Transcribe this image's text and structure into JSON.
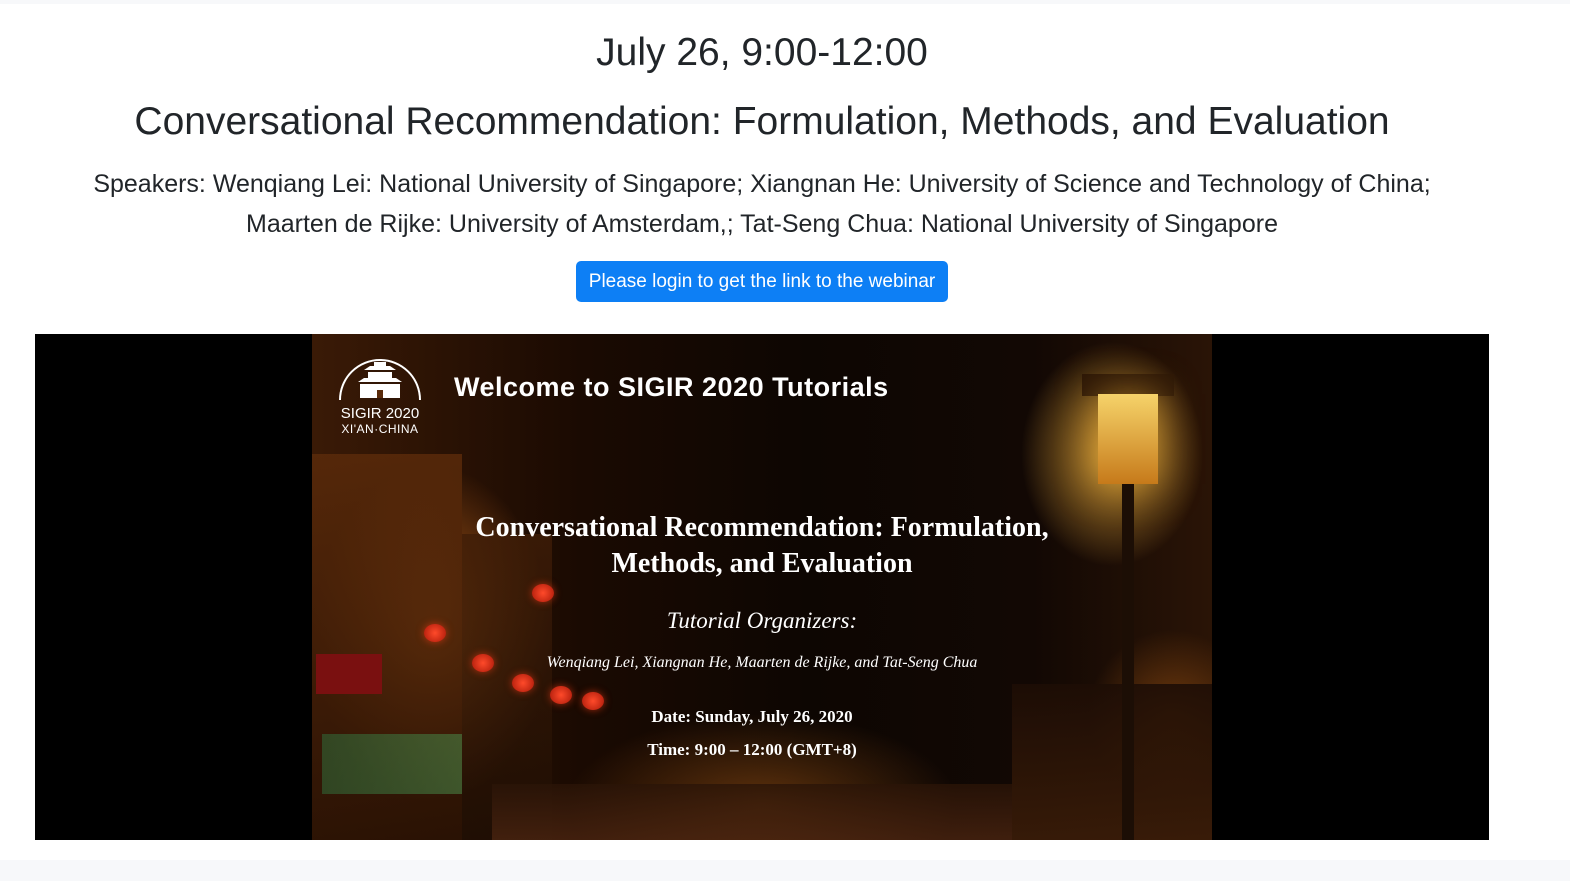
{
  "session": {
    "date_time": "July 26, 9:00-12:00",
    "title": "Conversational Recommendation: Formulation, Methods, and Evaluation",
    "speakers_line1": "Speakers: Wenqiang Lei: National University of Singapore; Xiangnan He: University of Science and Technology of China;",
    "speakers_line2": "Maarten de Rijke: University of Amsterdam,; Tat-Seng Chua: National University of Singapore",
    "login_button": "Please login to get the link to the webinar"
  },
  "slide": {
    "logo_name": "SIGIR 2020",
    "logo_place": "XI'AN·CHINA",
    "welcome": "Welcome to SIGIR 2020 Tutorials",
    "title_line1": "Conversational Recommendation: Formulation,",
    "title_line2": "Methods, and Evaluation",
    "organizers_label": "Tutorial Organizers:",
    "organizers": "Wenqiang Lei, Xiangnan He, Maarten de Rijke, and Tat-Seng Chua",
    "date": "Date: Sunday, July 26, 2020",
    "time": "Time: 9:00 – 12:00 (GMT+8)"
  }
}
